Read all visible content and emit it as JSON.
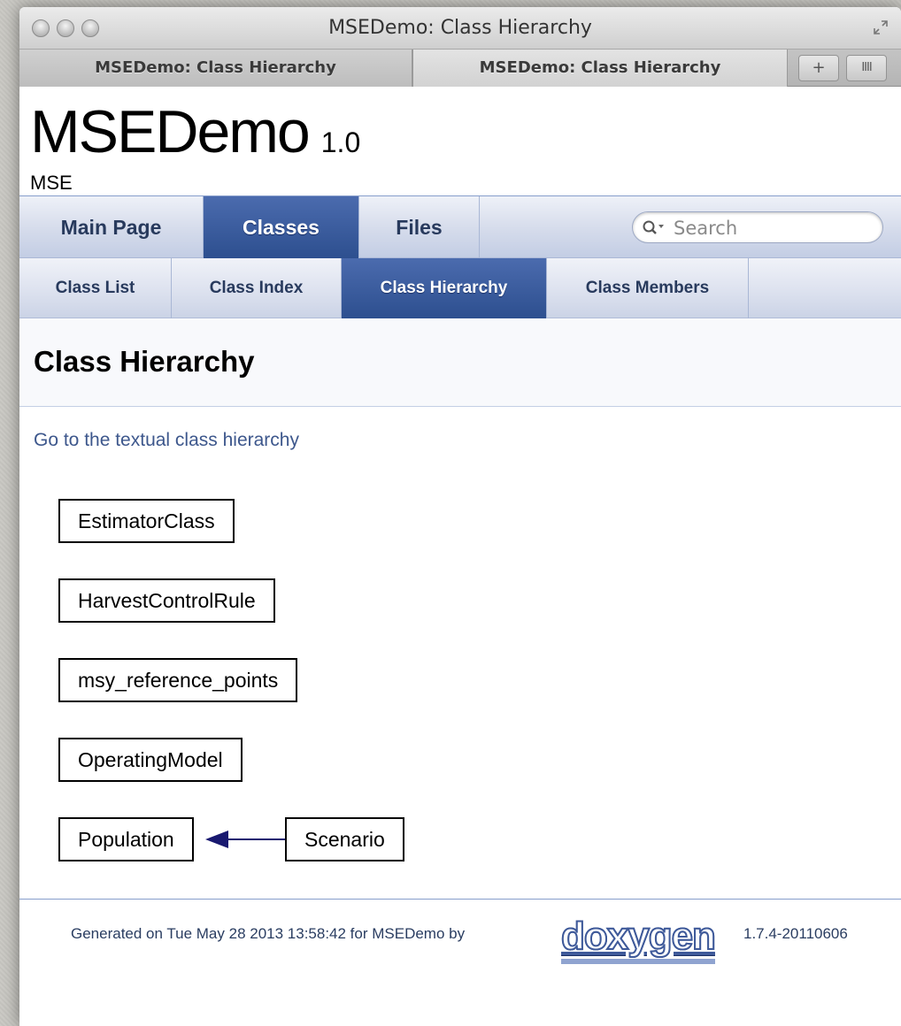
{
  "window": {
    "title": "MSEDemo: Class Hierarchy"
  },
  "browser_tabs": [
    {
      "label": "MSEDemo: Class Hierarchy",
      "active": false
    },
    {
      "label": "MSEDemo: Class Hierarchy",
      "active": true
    }
  ],
  "tab_buttons": {
    "new_tab_label": "+",
    "show_all_label": "IIII"
  },
  "header": {
    "project_name": "MSEDemo",
    "project_number": "1.0",
    "project_brief": "MSE"
  },
  "main_nav": [
    {
      "label": "Main Page",
      "current": false
    },
    {
      "label": "Classes",
      "current": true
    },
    {
      "label": "Files",
      "current": false
    }
  ],
  "search": {
    "placeholder": "Search"
  },
  "sub_nav": [
    {
      "label": "Class List",
      "current": false
    },
    {
      "label": "Class Index",
      "current": false
    },
    {
      "label": "Class Hierarchy",
      "current": true
    },
    {
      "label": "Class Members",
      "current": false
    }
  ],
  "page": {
    "title": "Class Hierarchy",
    "textual_link": "Go to the textual class hierarchy"
  },
  "classes": [
    {
      "name": "EstimatorClass"
    },
    {
      "name": "HarvestControlRule"
    },
    {
      "name": "msy_reference_points"
    },
    {
      "name": "OperatingModel"
    },
    {
      "name": "Population"
    },
    {
      "name": "Scenario"
    }
  ],
  "inheritance": [
    {
      "derived": "Scenario",
      "base": "Population"
    }
  ],
  "footer": {
    "generated_text": "Generated on Tue May 28 2013 13:58:42 for MSEDemo by",
    "logo_text": "doxygen",
    "version": "1.7.4-20110606"
  },
  "colors": {
    "nav_current": "#3b5998",
    "link": "#3d578c",
    "arrow": "#191970"
  }
}
